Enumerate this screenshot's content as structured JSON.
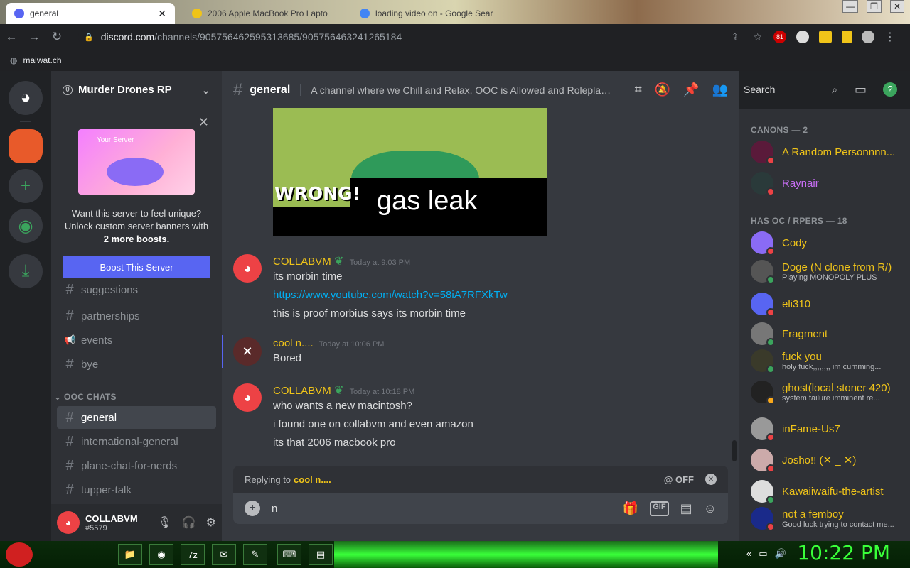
{
  "browser": {
    "tabs": [
      {
        "label": "general",
        "close": "✕"
      },
      {
        "label": "2006 Apple MacBook Pro Lapto"
      },
      {
        "label": "loading video on - Google Sear"
      }
    ],
    "url_domain": "discord.com",
    "url_path": "/channels/905756462595313685/905756463241265184",
    "bookmark": "malwat.ch",
    "ext_badge": "81"
  },
  "server": {
    "name": "Murder Drones RP",
    "boost": {
      "card_title": "Your Server",
      "text1": "Want this server to feel unique?",
      "text2": "Unlock custom server banners with",
      "text3": "2 more boosts.",
      "button": "Boost This Server"
    },
    "channels": [
      {
        "label": "suggestions",
        "icon": "#"
      },
      {
        "label": "partnerships",
        "icon": "#"
      },
      {
        "label": "events",
        "icon": "📢"
      },
      {
        "label": "bye",
        "icon": "#"
      }
    ],
    "category": "OOC CHATS",
    "ooc_channels": [
      {
        "label": "general",
        "icon": "#"
      },
      {
        "label": "international-general",
        "icon": "#"
      },
      {
        "label": "plane-chat-for-nerds",
        "icon": "#"
      },
      {
        "label": "tupper-talk",
        "icon": "#"
      }
    ]
  },
  "user": {
    "name": "COLLABVM",
    "tag": "#5579"
  },
  "channel": {
    "name": "general",
    "topic": "A channel where we Chill and Relax, OOC is Allowed and Roleplay is n...",
    "search_placeholder": "Search"
  },
  "meme": {
    "text1": "WRONG!",
    "text2": "gas leak"
  },
  "messages": [
    {
      "author": "COLLABVM",
      "time": "Today at 9:03 PM",
      "lines": [
        "its morbin time",
        "https://www.youtube.com/watch?v=58iA7RFXkTw",
        "this is proof morbius says its morbin time"
      ]
    },
    {
      "author": "cool n....",
      "time": "Today at 10:06 PM",
      "lines": [
        "Bored"
      ]
    },
    {
      "author": "COLLABVM",
      "time": "Today at 10:18 PM",
      "lines": [
        "who wants a new macintosh?",
        "i found one on collabvm and even amazon",
        "its that 2006 macbook pro"
      ]
    }
  ],
  "reply": {
    "prefix": "Replying to",
    "target": "cool n....",
    "ping": "@ OFF"
  },
  "composer": {
    "value": "n"
  },
  "members": {
    "cat1": "CANONS — 2",
    "cat2": "HAS OC / RPERS — 18",
    "list1": [
      {
        "name": "A Random Personnnn...",
        "color": "#f0c419",
        "status": "#ed4245"
      },
      {
        "name": "Raynair",
        "color": "#c86ef5",
        "status": "#ed4245"
      }
    ],
    "list2": [
      {
        "name": "Cody",
        "sub": "",
        "status": "#ed4245"
      },
      {
        "name": "Doge (N clone from R/)",
        "sub": "Playing MONOPOLY PLUS",
        "status": "#3ba55d"
      },
      {
        "name": "eli310",
        "sub": "",
        "status": "#ed4245"
      },
      {
        "name": "Fragment",
        "sub": "",
        "status": "#3ba55d"
      },
      {
        "name": "fuck you",
        "sub": "holy fuck,,,,,,,, im cumming...",
        "status": "#3ba55d"
      },
      {
        "name": "ghost(local stoner 420)",
        "sub": "system failure imminent re...",
        "status": "#faa81a"
      },
      {
        "name": "inFame-Us7",
        "sub": "",
        "status": "#ed4245"
      },
      {
        "name": "Josho!! (✕ _ ✕)",
        "sub": "",
        "status": "#ed4245"
      },
      {
        "name": "Kawaiiwaifu-the-artist",
        "sub": "",
        "status": "#3ba55d"
      },
      {
        "name": "not a femboy",
        "sub": "Good luck trying to contact me...",
        "status": "#ed4245"
      }
    ]
  },
  "taskbar": {
    "clock": "10:22 PM"
  }
}
